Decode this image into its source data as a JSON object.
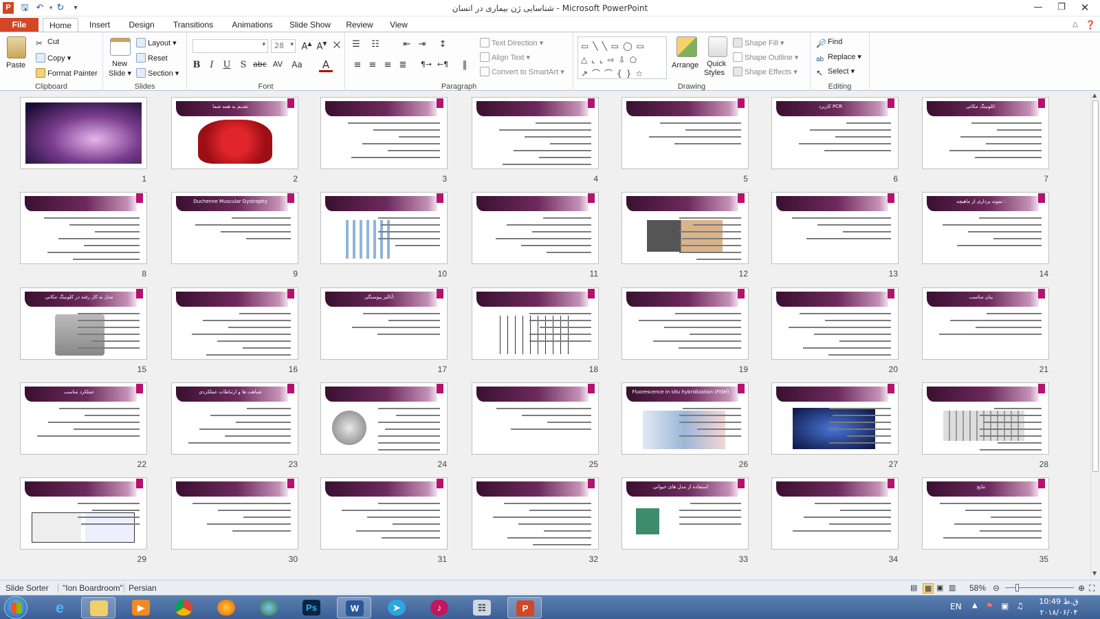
{
  "window": {
    "title": "شناسایی ژن بیماری در انسان  -  Microsoft PowerPoint"
  },
  "tabs": [
    {
      "label": "File"
    },
    {
      "label": "Home"
    },
    {
      "label": "Insert"
    },
    {
      "label": "Design"
    },
    {
      "label": "Transitions"
    },
    {
      "label": "Animations"
    },
    {
      "label": "Slide Show"
    },
    {
      "label": "Review"
    },
    {
      "label": "View"
    }
  ],
  "ribbon": {
    "clipboard": {
      "label": "Clipboard",
      "paste": "Paste",
      "cut": "Cut",
      "copy": "Copy",
      "format_painter": "Format Painter"
    },
    "slides": {
      "label": "Slides",
      "new_slide": "New",
      "new_slide2": "Slide",
      "layout": "Layout",
      "reset": "Reset",
      "section": "Section"
    },
    "font": {
      "label": "Font",
      "font_size": "28"
    },
    "paragraph": {
      "label": "Paragraph",
      "text_direction": "Text Direction",
      "align_text": "Align Text",
      "convert_smartart": "Convert to SmartArt"
    },
    "drawing": {
      "label": "Drawing",
      "arrange": "Arrange",
      "quick_styles": "Quick",
      "quick_styles2": "Styles",
      "shape_fill": "Shape Fill",
      "shape_outline": "Shape Outline",
      "shape_effects": "Shape Effects"
    },
    "editing": {
      "label": "Editing",
      "find": "Find",
      "replace": "Replace",
      "select": "Select"
    }
  },
  "slides": [
    {
      "num": "1",
      "title": ""
    },
    {
      "num": "2",
      "title": "تقدیم به همه شما"
    },
    {
      "num": "3",
      "title": ""
    },
    {
      "num": "4",
      "title": ""
    },
    {
      "num": "5",
      "title": ""
    },
    {
      "num": "6",
      "title": "کاربرد PCR"
    },
    {
      "num": "7",
      "title": "کلونینگ مکانی:"
    },
    {
      "num": "8",
      "title": ""
    },
    {
      "num": "9",
      "title": "Duchenne Muscular Dystrophy"
    },
    {
      "num": "10",
      "title": ""
    },
    {
      "num": "11",
      "title": ""
    },
    {
      "num": "12",
      "title": ""
    },
    {
      "num": "13",
      "title": ""
    },
    {
      "num": "14",
      "title": "نمونه برداری از ماهیچه :"
    },
    {
      "num": "15",
      "title": "مدل به کار رفته در کلونینگ مکانی"
    },
    {
      "num": "16",
      "title": ""
    },
    {
      "num": "17",
      "title": "آنالیز پیوستگی:"
    },
    {
      "num": "18",
      "title": ""
    },
    {
      "num": "19",
      "title": ""
    },
    {
      "num": "20",
      "title": ""
    },
    {
      "num": "21",
      "title": "بیان مناسب"
    },
    {
      "num": "22",
      "title": "عملکرد مناسب"
    },
    {
      "num": "23",
      "title": "شباهت ها و ارتباطات عملکردی"
    },
    {
      "num": "24",
      "title": ""
    },
    {
      "num": "25",
      "title": ""
    },
    {
      "num": "26",
      "title": "Fluorescence in situ hybridization (FISH)"
    },
    {
      "num": "27",
      "title": ""
    },
    {
      "num": "28",
      "title": ""
    },
    {
      "num": "29",
      "title": ""
    },
    {
      "num": "30",
      "title": ""
    },
    {
      "num": "31",
      "title": ""
    },
    {
      "num": "32",
      "title": ""
    },
    {
      "num": "33",
      "title": "استفاده از مدل های حیوانی"
    },
    {
      "num": "34",
      "title": ""
    },
    {
      "num": "35",
      "title": "نتایج"
    }
  ],
  "status": {
    "view": "Slide Sorter",
    "theme": "\"Ion Boardroom\"",
    "language": "Persian",
    "zoom": "58%"
  },
  "tray": {
    "lang": "EN",
    "time": "10:49 ق.ظ",
    "date": "۲۰۱۸/۰۶/۰۴"
  },
  "colors": {
    "file_tab": "#d24726",
    "accent": "#b5126f",
    "header": "#5a1f4e"
  }
}
